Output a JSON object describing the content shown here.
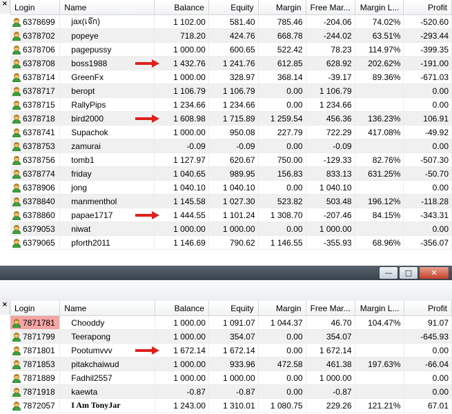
{
  "close_glyph": "×",
  "columns": {
    "login": "Login",
    "name": "Name",
    "balance": "Balance",
    "equity": "Equity",
    "margin": "Margin",
    "free_margin": "Free Mar...",
    "margin_level": "Margin L...",
    "profit": "Profit"
  },
  "window_buttons": {
    "minimize": "—",
    "maximize": "□",
    "close": "✕"
  },
  "panel1": {
    "rows": [
      {
        "login": "6378699",
        "name": "jax(เจ๊ก)",
        "balance": "1 102.00",
        "equity": "581.40",
        "margin": "785.46",
        "free_margin": "-204.06",
        "margin_level": "74.02%",
        "profit": "-520.60",
        "arrow": false
      },
      {
        "login": "6378702",
        "name": "popeye",
        "balance": "718.20",
        "equity": "424.76",
        "margin": "668.78",
        "free_margin": "-244.02",
        "margin_level": "63.51%",
        "profit": "-293.44",
        "arrow": false
      },
      {
        "login": "6378706",
        "name": "pagepussy",
        "balance": "1 000.00",
        "equity": "600.65",
        "margin": "522.42",
        "free_margin": "78.23",
        "margin_level": "114.97%",
        "profit": "-399.35",
        "arrow": false
      },
      {
        "login": "6378708",
        "name": "boss1988",
        "balance": "1 432.76",
        "equity": "1 241.76",
        "margin": "612.85",
        "free_margin": "628.92",
        "margin_level": "202.62%",
        "profit": "-191.00",
        "arrow": true
      },
      {
        "login": "6378714",
        "name": "GreenFx",
        "balance": "1 000.00",
        "equity": "328.97",
        "margin": "368.14",
        "free_margin": "-39.17",
        "margin_level": "89.36%",
        "profit": "-671.03",
        "arrow": false
      },
      {
        "login": "6378717",
        "name": "beropt",
        "balance": "1 106.79",
        "equity": "1 106.79",
        "margin": "0.00",
        "free_margin": "1 106.79",
        "margin_level": "",
        "profit": "0.00",
        "arrow": false
      },
      {
        "login": "6378715",
        "name": "RallyPips",
        "balance": "1 234.66",
        "equity": "1 234.66",
        "margin": "0.00",
        "free_margin": "1 234.66",
        "margin_level": "",
        "profit": "0.00",
        "arrow": false
      },
      {
        "login": "6378718",
        "name": "bird2000",
        "balance": "1 608.98",
        "equity": "1 715.89",
        "margin": "1 259.54",
        "free_margin": "456.36",
        "margin_level": "136.23%",
        "profit": "106.91",
        "arrow": true
      },
      {
        "login": "6378741",
        "name": "Supachok",
        "balance": "1 000.00",
        "equity": "950.08",
        "margin": "227.79",
        "free_margin": "722.29",
        "margin_level": "417.08%",
        "profit": "-49.92",
        "arrow": false
      },
      {
        "login": "6378753",
        "name": "zamurai",
        "balance": "-0.09",
        "equity": "-0.09",
        "margin": "0.00",
        "free_margin": "-0.09",
        "margin_level": "",
        "profit": "0.00",
        "arrow": false
      },
      {
        "login": "6378756",
        "name": "tomb1",
        "balance": "1 127.97",
        "equity": "620.67",
        "margin": "750.00",
        "free_margin": "-129.33",
        "margin_level": "82.76%",
        "profit": "-507.30",
        "arrow": false
      },
      {
        "login": "6378774",
        "name": "friday",
        "balance": "1 040.65",
        "equity": "989.95",
        "margin": "156.83",
        "free_margin": "833.13",
        "margin_level": "631.25%",
        "profit": "-50.70",
        "arrow": false
      },
      {
        "login": "6378906",
        "name": "jong",
        "balance": "1 040.10",
        "equity": "1 040.10",
        "margin": "0.00",
        "free_margin": "1 040.10",
        "margin_level": "",
        "profit": "0.00",
        "arrow": false
      },
      {
        "login": "6378840",
        "name": "manmenthol",
        "balance": "1 145.58",
        "equity": "1 027.30",
        "margin": "523.82",
        "free_margin": "503.48",
        "margin_level": "196.12%",
        "profit": "-118.28",
        "arrow": false
      },
      {
        "login": "6378860",
        "name": "papae1717",
        "balance": "1 444.55",
        "equity": "1 101.24",
        "margin": "1 308.70",
        "free_margin": "-207.46",
        "margin_level": "84.15%",
        "profit": "-343.31",
        "arrow": true
      },
      {
        "login": "6379053",
        "name": "niwat",
        "balance": "1 000.00",
        "equity": "1 000.00",
        "margin": "0.00",
        "free_margin": "1 000.00",
        "margin_level": "",
        "profit": "0.00",
        "arrow": false
      },
      {
        "login": "6379065",
        "name": "pforth2011",
        "balance": "1 146.69",
        "equity": "790.62",
        "margin": "1 146.55",
        "free_margin": "-355.93",
        "margin_level": "68.96%",
        "profit": "-356.07",
        "arrow": false
      }
    ]
  },
  "panel2": {
    "rows": [
      {
        "login": "7871781",
        "name": "Chooddy",
        "balance": "1 000.00",
        "equity": "1 091.07",
        "margin": "1 044.37",
        "free_margin": "46.70",
        "margin_level": "104.47%",
        "profit": "91.07",
        "arrow": false,
        "highlight": true
      },
      {
        "login": "7871799",
        "name": "Teerapong",
        "balance": "1 000.00",
        "equity": "354.07",
        "margin": "0.00",
        "free_margin": "354.07",
        "margin_level": "",
        "profit": "-645.93",
        "arrow": false
      },
      {
        "login": "7871801",
        "name": "Pootumvvv",
        "balance": "1 672.14",
        "equity": "1 672.14",
        "margin": "0.00",
        "free_margin": "1 672.14",
        "margin_level": "",
        "profit": "0.00",
        "arrow": true
      },
      {
        "login": "7871853",
        "name": "pitakchaiwud",
        "balance": "1 000.00",
        "equity": "933.96",
        "margin": "472.58",
        "free_margin": "461.38",
        "margin_level": "197.63%",
        "profit": "-66.04",
        "arrow": false
      },
      {
        "login": "7871889",
        "name": "Fadhil2557",
        "balance": "1 000.00",
        "equity": "1 000.00",
        "margin": "0.00",
        "free_margin": "1 000.00",
        "margin_level": "",
        "profit": "0.00",
        "arrow": false
      },
      {
        "login": "7871918",
        "name": "kaewta",
        "balance": "-0.87",
        "equity": "-0.87",
        "margin": "0.00",
        "free_margin": "-0.87",
        "margin_level": "",
        "profit": "0.00",
        "arrow": false
      },
      {
        "login": "7872057",
        "name": "I Am TonyJar",
        "balance": "1 243.00",
        "equity": "1 310.01",
        "margin": "1 080.75",
        "free_margin": "229.26",
        "margin_level": "121.21%",
        "profit": "67.01",
        "arrow": false,
        "fancy": true
      }
    ]
  },
  "colors": {
    "arrow": "#e0201b",
    "highlight": "#f4a4a4",
    "user_icon_face": "#f2c36b",
    "user_icon_body": "#3aa43a"
  }
}
